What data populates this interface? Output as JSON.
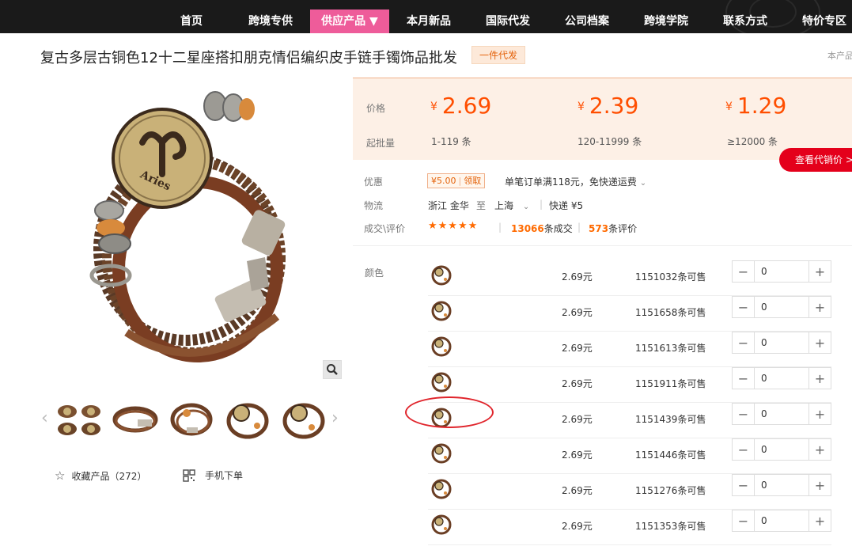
{
  "nav": {
    "items": [
      "首页",
      "跨境专供",
      "供应产品 ▼",
      "本月新品",
      "国际代发",
      "公司档案",
      "跨境学院",
      "联系方式",
      "特价专区"
    ],
    "active_index": 2,
    "active_color": "#ee5c9a"
  },
  "product": {
    "title": "复古多层古铜色12十二星座搭扣朋克情侣编织皮手链手镯饰品批发",
    "badge": "一件代发",
    "right_note": "本产品"
  },
  "price_panel": {
    "price_label": "价格",
    "moq_label": "起批量",
    "currency": "¥",
    "tiers": [
      {
        "price": "2.69",
        "moq": "1-119 条"
      },
      {
        "price": "2.39",
        "moq": "120-11999 条"
      },
      {
        "price": "1.29",
        "moq": "≥12000 条"
      }
    ],
    "agent_price_button": "查看代销价 >"
  },
  "info": {
    "discount_label": "优惠",
    "coupon_value": "¥5.00",
    "coupon_action": "领取",
    "discount_text": "单笔订单满118元，免快递运费",
    "logistics_label": "物流",
    "from": "浙江 金华",
    "to_word": "至",
    "dest": "上海",
    "shipping": "快递 ¥5",
    "deal_label": "成交\\评价",
    "rating": 5,
    "deals_count": "13066",
    "deals_suffix": "条成交",
    "reviews_count": "573",
    "reviews_suffix": "条评价"
  },
  "gallery": {
    "thumb_count": 5,
    "favorite_label": "收藏产品（272）",
    "mobile_label": "手机下单"
  },
  "sku": {
    "color_label": "颜色",
    "rows": [
      {
        "price": "2.69元",
        "stock": "1151032条可售",
        "qty": "0"
      },
      {
        "price": "2.69元",
        "stock": "1151658条可售",
        "qty": "0"
      },
      {
        "price": "2.69元",
        "stock": "1151613条可售",
        "qty": "0"
      },
      {
        "price": "2.69元",
        "stock": "1151911条可售",
        "qty": "0"
      },
      {
        "price": "2.69元",
        "stock": "1151439条可售",
        "qty": "0"
      },
      {
        "price": "2.69元",
        "stock": "1151446条可售",
        "qty": "0"
      },
      {
        "price": "2.69元",
        "stock": "1151276条可售",
        "qty": "0"
      },
      {
        "price": "2.69元",
        "stock": "1151353条可售",
        "qty": "0"
      }
    ],
    "highlighted_row": 5
  }
}
